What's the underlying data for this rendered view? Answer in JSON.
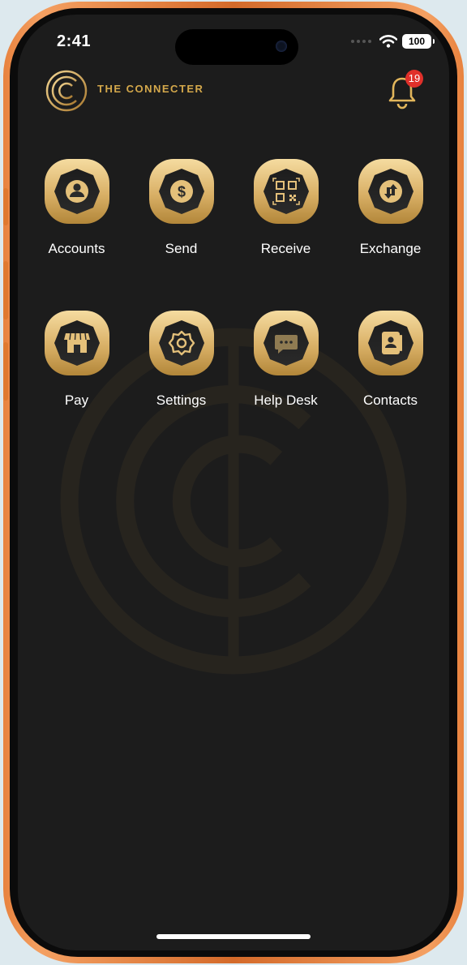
{
  "status_bar": {
    "time": "2:41",
    "battery": "100",
    "wifi_icon": "wifi-icon",
    "signal_icon": "cellular-signal-icon"
  },
  "header": {
    "brand_name": "THE CONNECTER",
    "logo_icon": "connecter-logo-icon",
    "notification_icon": "bell-icon",
    "notification_count": "19"
  },
  "colors": {
    "background": "#1c1c1c",
    "gold_light": "#f3d693",
    "gold_dark": "#b48a3e",
    "badge": "#e0302a",
    "frame": "#e8823e"
  },
  "menu": [
    {
      "label": "Accounts",
      "icon": "account-user-icon"
    },
    {
      "label": "Send",
      "icon": "dollar-coin-icon"
    },
    {
      "label": "Receive",
      "icon": "qr-code-icon"
    },
    {
      "label": "Exchange",
      "icon": "exchange-arrows-icon"
    },
    {
      "label": "Pay",
      "icon": "storefront-icon"
    },
    {
      "label": "Settings",
      "icon": "gear-icon"
    },
    {
      "label": "Help Desk",
      "icon": "chat-bubble-icon"
    },
    {
      "label": "Contacts",
      "icon": "contact-book-icon"
    }
  ]
}
